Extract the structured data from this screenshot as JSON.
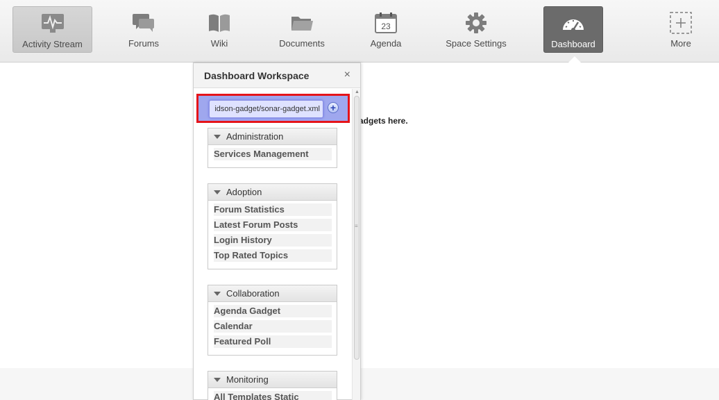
{
  "toolbar": {
    "tabs": [
      {
        "label": "Activity Stream",
        "icon": "activity-stream-icon"
      },
      {
        "label": "Forums",
        "icon": "forums-icon"
      },
      {
        "label": "Wiki",
        "icon": "wiki-icon"
      },
      {
        "label": "Documents",
        "icon": "documents-icon"
      },
      {
        "label": "Agenda",
        "icon": "agenda-icon",
        "icon_text": "23"
      },
      {
        "label": "Space Settings",
        "icon": "gear-icon"
      },
      {
        "label": "Dashboard",
        "icon": "dashboard-icon"
      },
      {
        "label": "More",
        "icon": "more-icon"
      }
    ]
  },
  "main": {
    "hint_text": "adgets here."
  },
  "panel": {
    "title": "Dashboard Workspace",
    "close_glyph": "×",
    "url_value": "idson-gadget/sonar-gadget.xml",
    "add_glyph": "+",
    "categories": [
      {
        "title": "Administration",
        "items": [
          "Services Management"
        ]
      },
      {
        "title": "Adoption",
        "items": [
          "Forum Statistics",
          "Latest Forum Posts",
          "Login History",
          "Top Rated Topics"
        ]
      },
      {
        "title": "Collaboration",
        "items": [
          "Agenda Gadget",
          "Calendar",
          "Featured Poll"
        ]
      },
      {
        "title": "Monitoring",
        "items": [
          "All Templates Static"
        ]
      }
    ]
  },
  "colors": {
    "active_tab": "#6b6b6b",
    "highlight_border": "#e5141a",
    "url_highlight": "#9fa7ee"
  }
}
